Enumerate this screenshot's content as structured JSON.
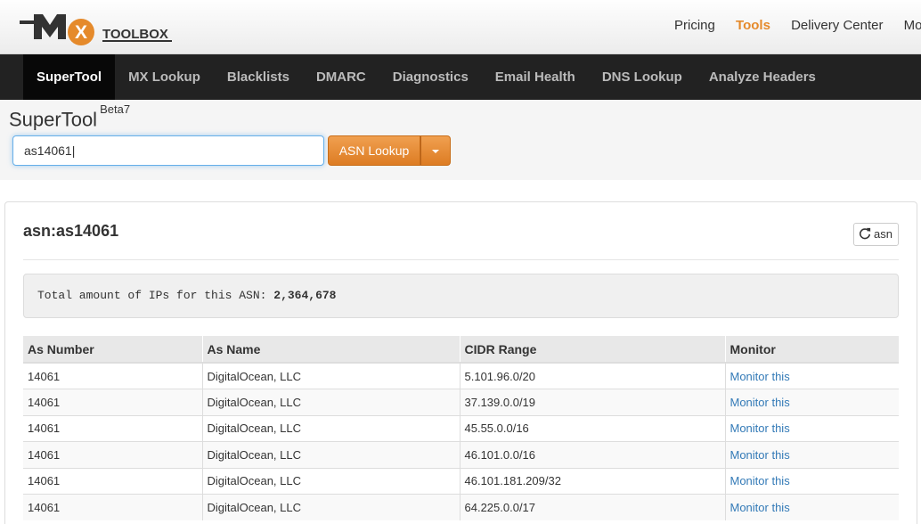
{
  "header": {
    "logo_text": "MX TOOLBOX",
    "links": [
      "Pricing",
      "Tools",
      "Delivery Center",
      "Monit"
    ],
    "active_link": "Tools"
  },
  "nav": {
    "items": [
      "SuperTool",
      "MX Lookup",
      "Blacklists",
      "DMARC",
      "Diagnostics",
      "Email Health",
      "DNS Lookup",
      "Analyze Headers"
    ],
    "active": "SuperTool"
  },
  "supertool": {
    "title": "SuperTool",
    "badge": "Beta7",
    "input_value": "as14061",
    "button_label": "ASN Lookup"
  },
  "result": {
    "title": "asn:as14061",
    "refresh_label": "asn",
    "summary_prefix": "Total amount of IPs for this ASN:",
    "summary_value": "2,364,678",
    "columns": [
      "As Number",
      "As Name",
      "CIDR Range",
      "Monitor"
    ],
    "rows": [
      {
        "as_number": "14061",
        "as_name": "DigitalOcean, LLC",
        "cidr": "5.101.96.0/20",
        "monitor": "Monitor this"
      },
      {
        "as_number": "14061",
        "as_name": "DigitalOcean, LLC",
        "cidr": "37.139.0.0/19",
        "monitor": "Monitor this"
      },
      {
        "as_number": "14061",
        "as_name": "DigitalOcean, LLC",
        "cidr": "45.55.0.0/16",
        "monitor": "Monitor this"
      },
      {
        "as_number": "14061",
        "as_name": "DigitalOcean, LLC",
        "cidr": "46.101.0.0/16",
        "monitor": "Monitor this"
      },
      {
        "as_number": "14061",
        "as_name": "DigitalOcean, LLC",
        "cidr": "46.101.181.209/32",
        "monitor": "Monitor this"
      },
      {
        "as_number": "14061",
        "as_name": "DigitalOcean, LLC",
        "cidr": "64.225.0.0/17",
        "monitor": "Monitor this"
      }
    ]
  },
  "colors": {
    "accent_orange": "#e58a2b",
    "nav_bg": "#222222",
    "link_blue": "#337ab7"
  }
}
